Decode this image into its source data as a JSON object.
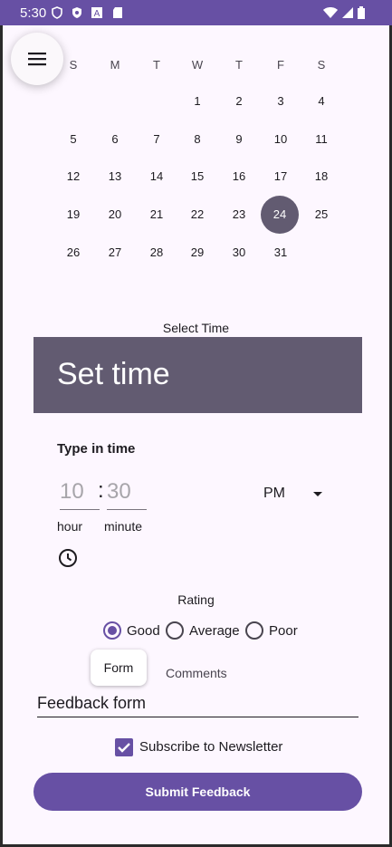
{
  "status_bar": {
    "time": "5:30",
    "icons_left": [
      "shield-icon",
      "security-icon",
      "a-badge-icon",
      "sd-card-icon"
    ],
    "icons_right": [
      "wifi-icon",
      "signal-icon",
      "battery-icon"
    ]
  },
  "menu_button": {
    "icon": "menu-icon"
  },
  "calendar": {
    "weekdays": [
      "S",
      "M",
      "T",
      "W",
      "T",
      "F",
      "S"
    ],
    "selected_day": "24",
    "weeks": [
      [
        "",
        "",
        "",
        "1",
        "2",
        "3",
        "4"
      ],
      [
        "5",
        "6",
        "7",
        "8",
        "9",
        "10",
        "11"
      ],
      [
        "12",
        "13",
        "14",
        "15",
        "16",
        "17",
        "18"
      ],
      [
        "19",
        "20",
        "21",
        "22",
        "23",
        "24",
        "25"
      ],
      [
        "26",
        "27",
        "28",
        "29",
        "30",
        "31",
        ""
      ]
    ]
  },
  "time_picker": {
    "select_label": "Select Time",
    "title": "Set time",
    "type_in_label": "Type in time",
    "hour_value": "10",
    "separator": ":",
    "minute_value": "30",
    "hour_label": "hour",
    "minute_label": "minute",
    "ampm": "PM",
    "clock_icon": "clock-icon"
  },
  "rating": {
    "label": "Rating",
    "options": [
      "Good",
      "Average",
      "Poor"
    ],
    "selected": "Good"
  },
  "form": {
    "chip_label": "Form",
    "comments_label": "Comments",
    "feedback_value": "Feedback form",
    "newsletter_label": "Subscribe to Newsletter",
    "newsletter_checked": true,
    "submit_label": "Submit Feedback"
  },
  "colors": {
    "primary": "#6750a4",
    "secondary": "#625b71",
    "background": "#fdf7ff"
  }
}
